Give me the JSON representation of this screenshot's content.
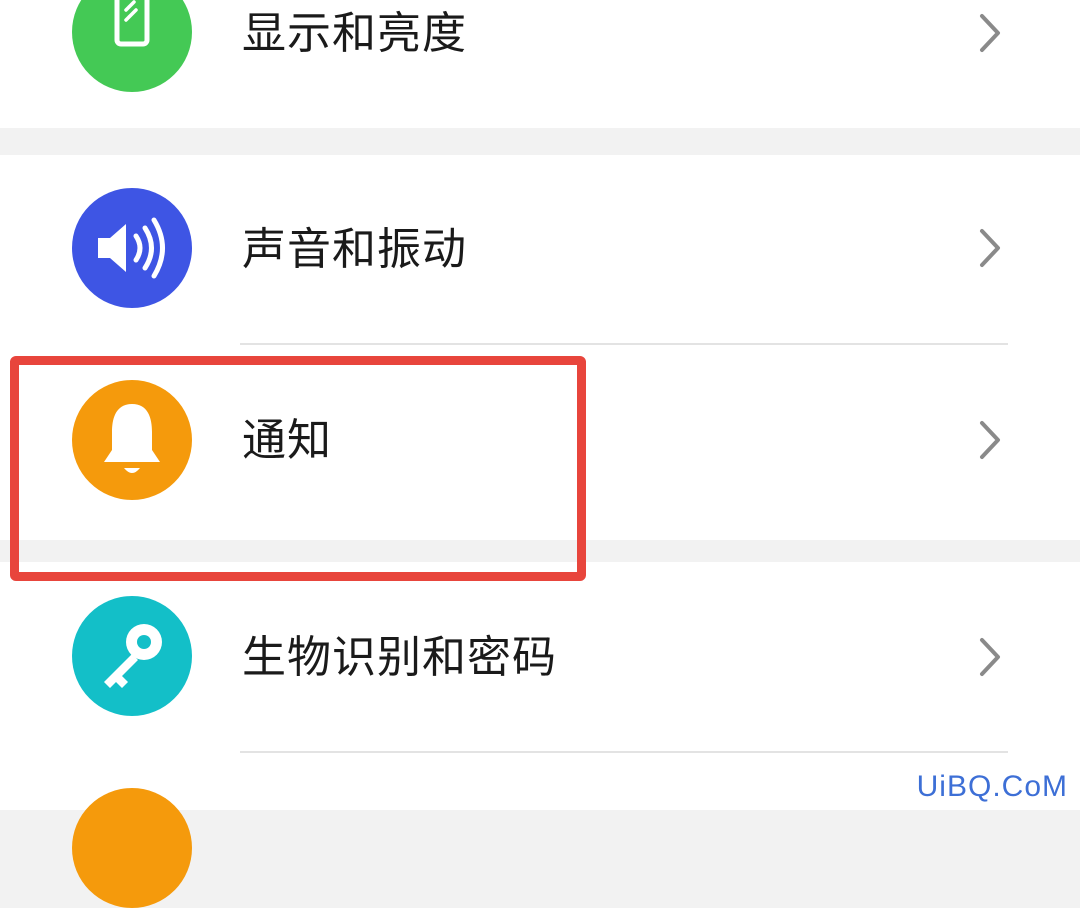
{
  "settings": {
    "items": [
      {
        "label": "显示和亮度",
        "icon": "phone-display-icon",
        "color": "#44c955"
      },
      {
        "label": "声音和振动",
        "icon": "speaker-icon",
        "color": "#3e55e4"
      },
      {
        "label": "通知",
        "icon": "bell-icon",
        "color": "#f59a0c"
      },
      {
        "label": "生物识别和密码",
        "icon": "key-icon",
        "color": "#13bfc8"
      },
      {
        "label": "",
        "icon": "partial-icon",
        "color": "#f59a0c"
      }
    ]
  },
  "highlight": {
    "color": "#e8453c"
  },
  "watermark": {
    "text": "UiBQ.CoM"
  }
}
